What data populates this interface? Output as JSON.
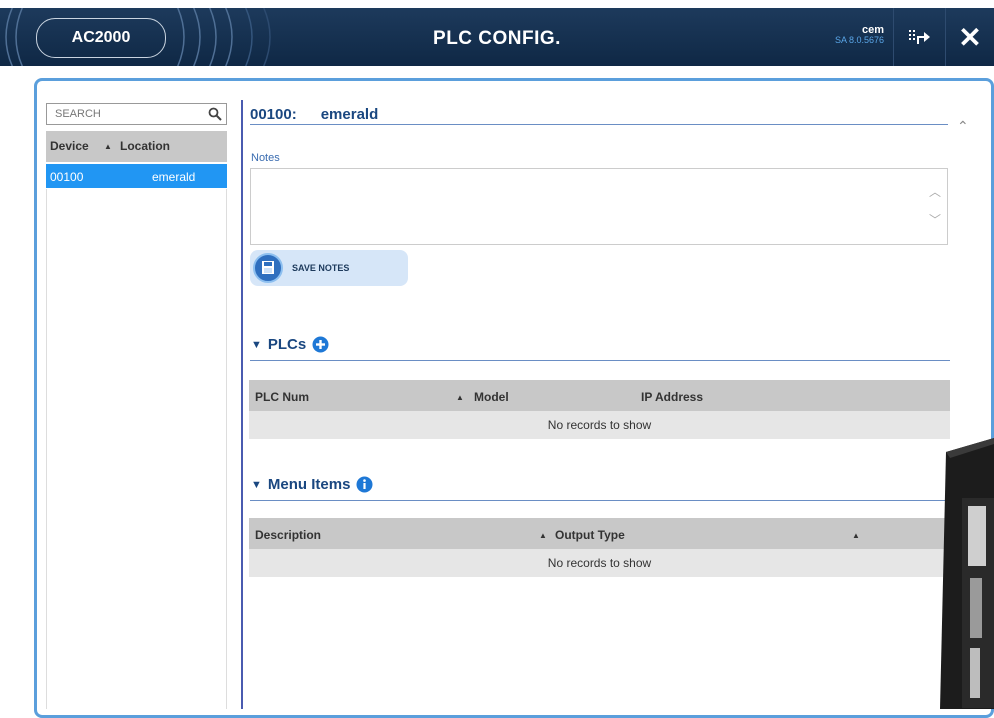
{
  "header": {
    "brand": "AC2000",
    "title": "PLC CONFIG.",
    "user": "cem",
    "version": "SA 8.0.5676"
  },
  "sidebar": {
    "search_placeholder": "SEARCH",
    "columns": [
      "Device",
      "Location"
    ],
    "rows": [
      {
        "device": "00100",
        "location": "emerald"
      }
    ]
  },
  "detail": {
    "device_id": "00100:",
    "location": "emerald",
    "notes_label": "Notes",
    "notes_value": "",
    "save_notes_label": "SAVE NOTES"
  },
  "plcs": {
    "title": "PLCs",
    "columns": [
      "PLC Num",
      "Model",
      "IP Address"
    ],
    "empty_text": "No records to show"
  },
  "menu_items": {
    "title": "Menu Items",
    "columns": [
      "Description",
      "Output Type"
    ],
    "empty_text": "No records to show"
  },
  "colors": {
    "header_bg": "#0f2845",
    "accent": "#2196f3",
    "panel_border": "#5b9fdc",
    "section_title": "#1a4780"
  }
}
